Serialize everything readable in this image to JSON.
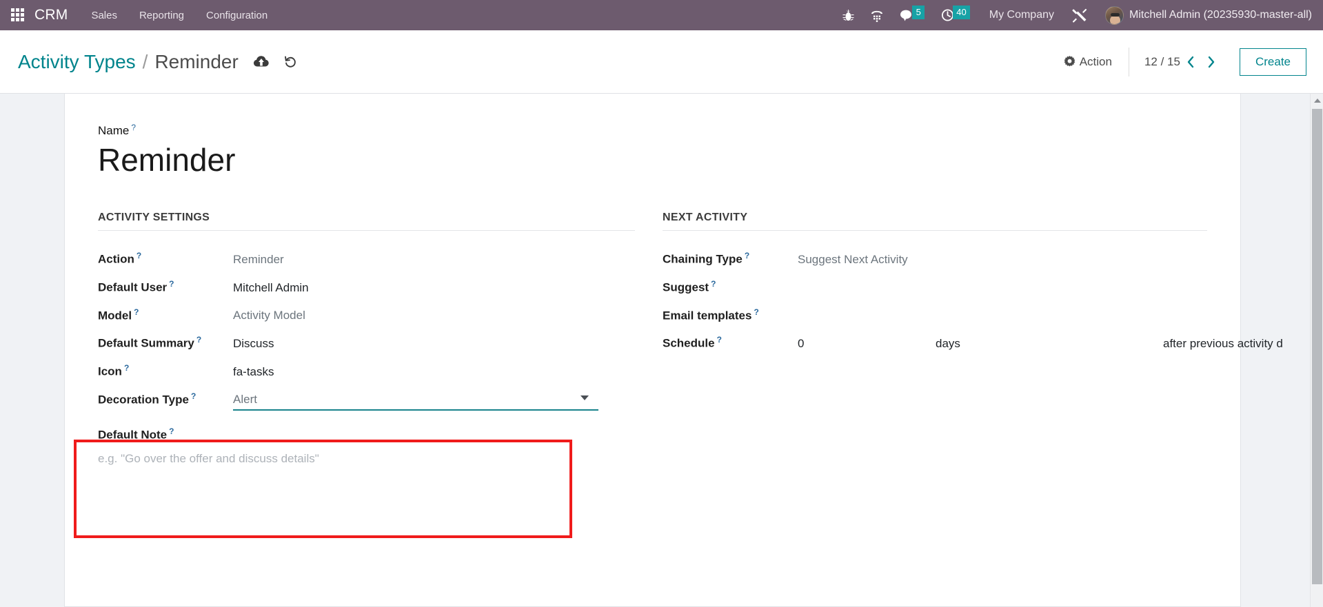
{
  "navbar": {
    "apps_icon": "apps-grid-icon",
    "brand": "CRM",
    "menus": [
      {
        "label": "Sales"
      },
      {
        "label": "Reporting"
      },
      {
        "label": "Configuration"
      }
    ],
    "icons": [
      {
        "name": "bug-icon"
      },
      {
        "name": "dialpad-icon"
      }
    ],
    "messaging": {
      "icon": "chat-bubble-icon",
      "count": "5"
    },
    "activities": {
      "icon": "clock-icon",
      "count": "40"
    },
    "company": "My Company",
    "tools_icon": "tools-icon",
    "avatar": "user-avatar",
    "username": "Mitchell Admin (20235930-master-all)",
    "badge_color": "#17a2a6",
    "background_color": "#6d5b6e"
  },
  "control_panel": {
    "breadcrumb": {
      "parent": "Activity Types",
      "separator": "/",
      "current": "Reminder"
    },
    "save_icon": "cloud-upload-icon",
    "discard_icon": "undo-icon",
    "action_label": "Action",
    "action_icon": "gear-icon",
    "pager": {
      "value": "12 / 15",
      "prev_icon": "chevron-left-icon",
      "next_icon": "chevron-right-icon"
    },
    "create_label": "Create",
    "accent_color": "#00848c"
  },
  "form": {
    "title_label": "Name",
    "title_value": "Reminder",
    "tooltip_marker": "?",
    "left_group": {
      "title": "ACTIVITY SETTINGS",
      "fields": [
        {
          "label": "Action",
          "value": "Reminder",
          "style": "muted"
        },
        {
          "label": "Default User",
          "value": "Mitchell Admin",
          "style": "normal"
        },
        {
          "label": "Model",
          "value": "Activity Model",
          "style": "muted"
        },
        {
          "label": "Default Summary",
          "value": "Discuss",
          "style": "normal"
        },
        {
          "label": "Icon",
          "value": "fa-tasks",
          "style": "normal"
        },
        {
          "label": "Decoration Type",
          "value": "Alert",
          "style": "muted"
        }
      ]
    },
    "right_group": {
      "title": "NEXT ACTIVITY",
      "fields": [
        {
          "label": "Chaining Type",
          "value": "Suggest Next Activity",
          "style": "muted"
        },
        {
          "label": "Suggest",
          "value": "",
          "style": "normal"
        },
        {
          "label": "Email templates",
          "value": "",
          "style": "normal"
        }
      ],
      "schedule": {
        "label": "Schedule",
        "interval": "0",
        "unit": "days",
        "trigger": "after previous activity d"
      }
    },
    "note": {
      "label": "Default Note",
      "placeholder": "e.g. \"Go over the offer and discuss details\""
    },
    "highlight_color": "#f01b1b",
    "focus_underline_color": "#18838c"
  },
  "scrollbar": {
    "up_arrow_icon": "scroll-up-arrow-icon"
  }
}
